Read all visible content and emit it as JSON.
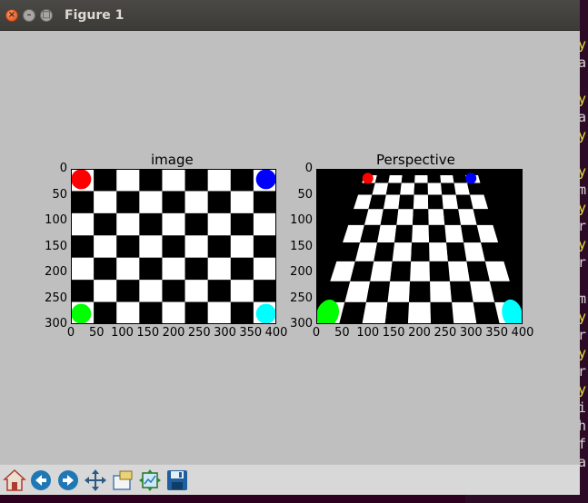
{
  "window": {
    "title": "Figure 1"
  },
  "toolbar": {
    "buttons": [
      {
        "name": "home-button",
        "icon": "home-icon"
      },
      {
        "name": "back-button",
        "icon": "arrow-left-icon"
      },
      {
        "name": "forward-button",
        "icon": "arrow-right-icon"
      },
      {
        "name": "pan-button",
        "icon": "move-icon"
      },
      {
        "name": "zoom-button",
        "icon": "zoom-rect-icon"
      },
      {
        "name": "subplots-button",
        "icon": "subplots-icon"
      },
      {
        "name": "save-button",
        "icon": "save-icon"
      }
    ]
  },
  "plots": [
    {
      "title": "image",
      "yticks": [
        "0",
        "50",
        "100",
        "150",
        "200",
        "250",
        "300"
      ],
      "xticks": [
        "0",
        "50",
        "100",
        "150",
        "200",
        "250",
        "300",
        "350",
        "400"
      ],
      "markers": [
        {
          "color": "#ff0000",
          "x": 20,
          "y": 20
        },
        {
          "color": "#0000ff",
          "x": 380,
          "y": 20
        },
        {
          "color": "#00ff00",
          "x": 20,
          "y": 280
        },
        {
          "color": "#00ffff",
          "x": 380,
          "y": 280
        }
      ]
    },
    {
      "title": "Perspective",
      "yticks": [
        "0",
        "50",
        "100",
        "150",
        "200",
        "250",
        "300"
      ],
      "xticks": [
        "0",
        "50",
        "100",
        "150",
        "200",
        "250",
        "300",
        "350",
        "400"
      ],
      "markers": [
        {
          "color": "#ff0000",
          "x": 100,
          "y": 20
        },
        {
          "color": "#0000ff",
          "x": 300,
          "y": 20
        },
        {
          "color": "#00ff00",
          "x": 22,
          "y": 280
        },
        {
          "color": "#00ffff",
          "x": 380,
          "y": 280
        }
      ]
    }
  ],
  "background_editor": {
    "lines": [
      {
        "text": "y",
        "color": "#e5e33a"
      },
      {
        "text": "a",
        "color": "#d8d8d8"
      },
      {
        "text": "",
        "color": "#d8d8d8"
      },
      {
        "text": "y",
        "color": "#e5e33a"
      },
      {
        "text": "a",
        "color": "#d8d8d8"
      },
      {
        "text": "y",
        "color": "#e5e33a"
      },
      {
        "text": "",
        "color": "#d8d8d8"
      },
      {
        "text": "y",
        "color": "#e5e33a"
      },
      {
        "text": "m",
        "color": "#d8d8d8"
      },
      {
        "text": "y",
        "color": "#e5e33a"
      },
      {
        "text": "r",
        "color": "#d8d8d8"
      },
      {
        "text": "y",
        "color": "#e5e33a"
      },
      {
        "text": "r",
        "color": "#d8d8d8"
      },
      {
        "text": "",
        "color": "#d8d8d8"
      },
      {
        "text": "m",
        "color": "#d8d8d8"
      },
      {
        "text": "y",
        "color": "#e5e33a"
      },
      {
        "text": "r",
        "color": "#d8d8d8"
      },
      {
        "text": "y",
        "color": "#e5e33a"
      },
      {
        "text": "r",
        "color": "#d8d8d8"
      },
      {
        "text": "y",
        "color": "#e5e33a"
      },
      {
        "text": "i",
        "color": "#d8d8d8"
      },
      {
        "text": "h",
        "color": "#d8d8d8"
      },
      {
        "text": "f",
        "color": "#d8d8d8"
      },
      {
        "text": "a",
        "color": "#d8d8d8"
      }
    ]
  }
}
